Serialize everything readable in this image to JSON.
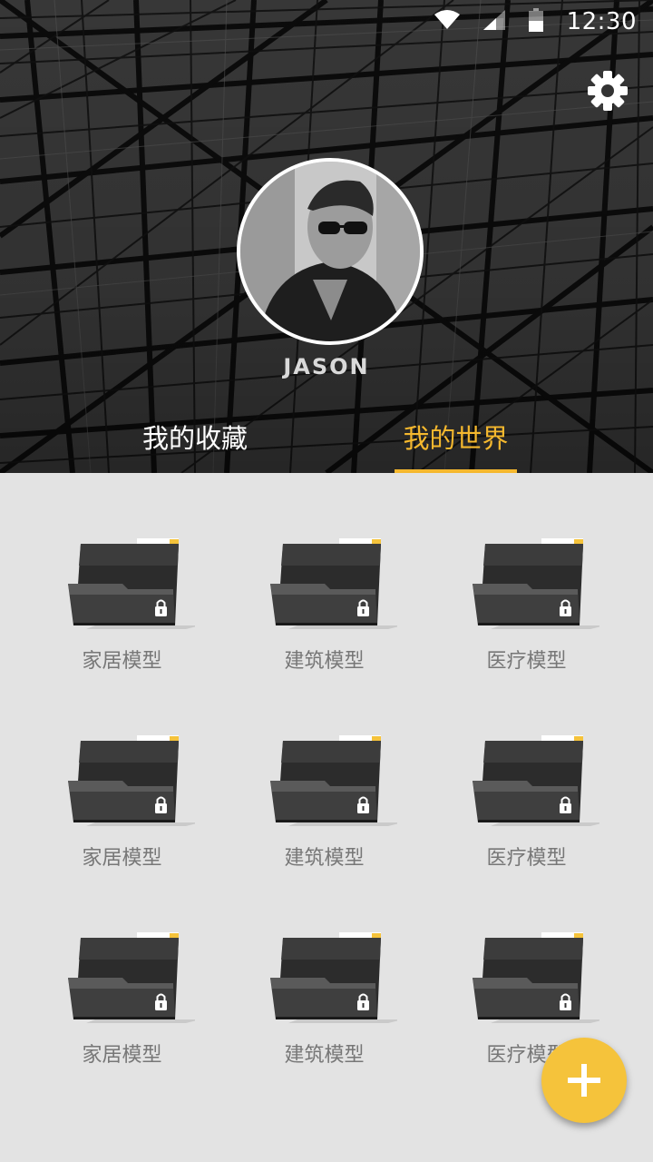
{
  "status_bar": {
    "time": "12:30",
    "wifi_icon": "wifi-icon",
    "signal_icon": "signal-icon",
    "battery_icon": "battery-icon"
  },
  "header": {
    "settings_icon": "gear-icon",
    "avatar_icon": "avatar",
    "username": "JASON"
  },
  "tabs": [
    {
      "label": "我的收藏",
      "active": false
    },
    {
      "label": "我的世界",
      "active": true
    }
  ],
  "folders": [
    {
      "label": "家居模型",
      "locked": true
    },
    {
      "label": "建筑模型",
      "locked": true
    },
    {
      "label": "医疗模型",
      "locked": true
    },
    {
      "label": "家居模型",
      "locked": true
    },
    {
      "label": "建筑模型",
      "locked": true
    },
    {
      "label": "医疗模型",
      "locked": true
    },
    {
      "label": "家居模型",
      "locked": true
    },
    {
      "label": "建筑模型",
      "locked": true
    },
    {
      "label": "医疗模型",
      "locked": true
    }
  ],
  "fab": {
    "icon": "plus-icon"
  },
  "colors": {
    "accent": "#f5b82e",
    "fab": "#f5c33b",
    "background": "#e3e3e3",
    "folder_label": "#777777"
  }
}
